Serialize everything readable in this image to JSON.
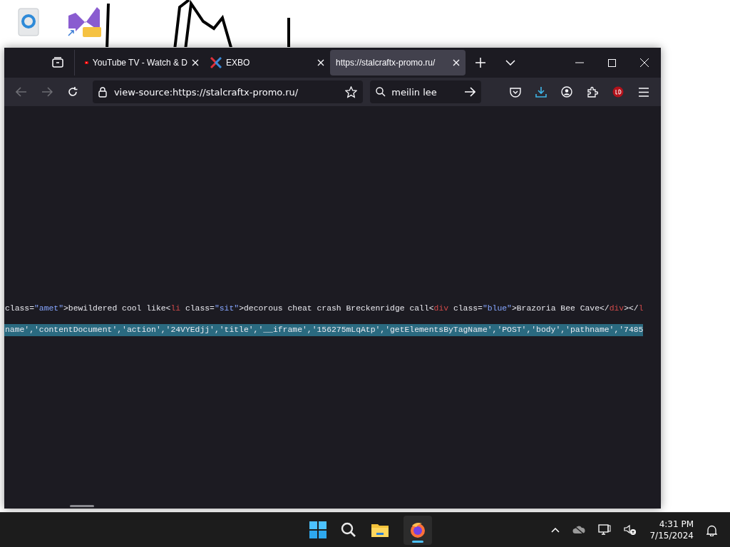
{
  "tabs": [
    {
      "title": "YouTube TV - Watch & D",
      "selected": false
    },
    {
      "title": "EXBO",
      "selected": false
    },
    {
      "title": "https://stalcraftx-promo.ru/",
      "selected": true
    }
  ],
  "address_bar": {
    "value": "view-source:https://stalcraftx-promo.ru/"
  },
  "search_field": {
    "value": "meilin lee"
  },
  "source_lines": [
    {
      "selected": false,
      "segments": [
        {
          "kind": "attr",
          "text": "class="
        },
        {
          "kind": "value",
          "text": "\"amet\""
        },
        {
          "kind": "text",
          "text": ">bewildered cool like<"
        },
        {
          "kind": "tag",
          "text": "li"
        },
        {
          "kind": "attr",
          "text": " class="
        },
        {
          "kind": "value",
          "text": "\"sit\""
        },
        {
          "kind": "text",
          "text": ">decorous cheat crash Breckenridge call<"
        },
        {
          "kind": "tag",
          "text": "div"
        },
        {
          "kind": "attr",
          "text": " class="
        },
        {
          "kind": "value",
          "text": "\"blue\""
        },
        {
          "kind": "text",
          "text": ">Brazoria Bee Cave</"
        },
        {
          "kind": "tag",
          "text": "div"
        },
        {
          "kind": "text",
          "text": "></"
        },
        {
          "kind": "tag",
          "text": "l"
        }
      ]
    },
    {
      "selected": true,
      "segments": [
        {
          "kind": "text",
          "text": "name','contentDocument','action','24VYEdjj','title','__iframe','156275mLqAtp','getElementsByTagName','POST','body','pathname','7485"
        }
      ]
    }
  ],
  "taskbar": {
    "time": "4:31 PM",
    "date": "7/15/2024"
  }
}
